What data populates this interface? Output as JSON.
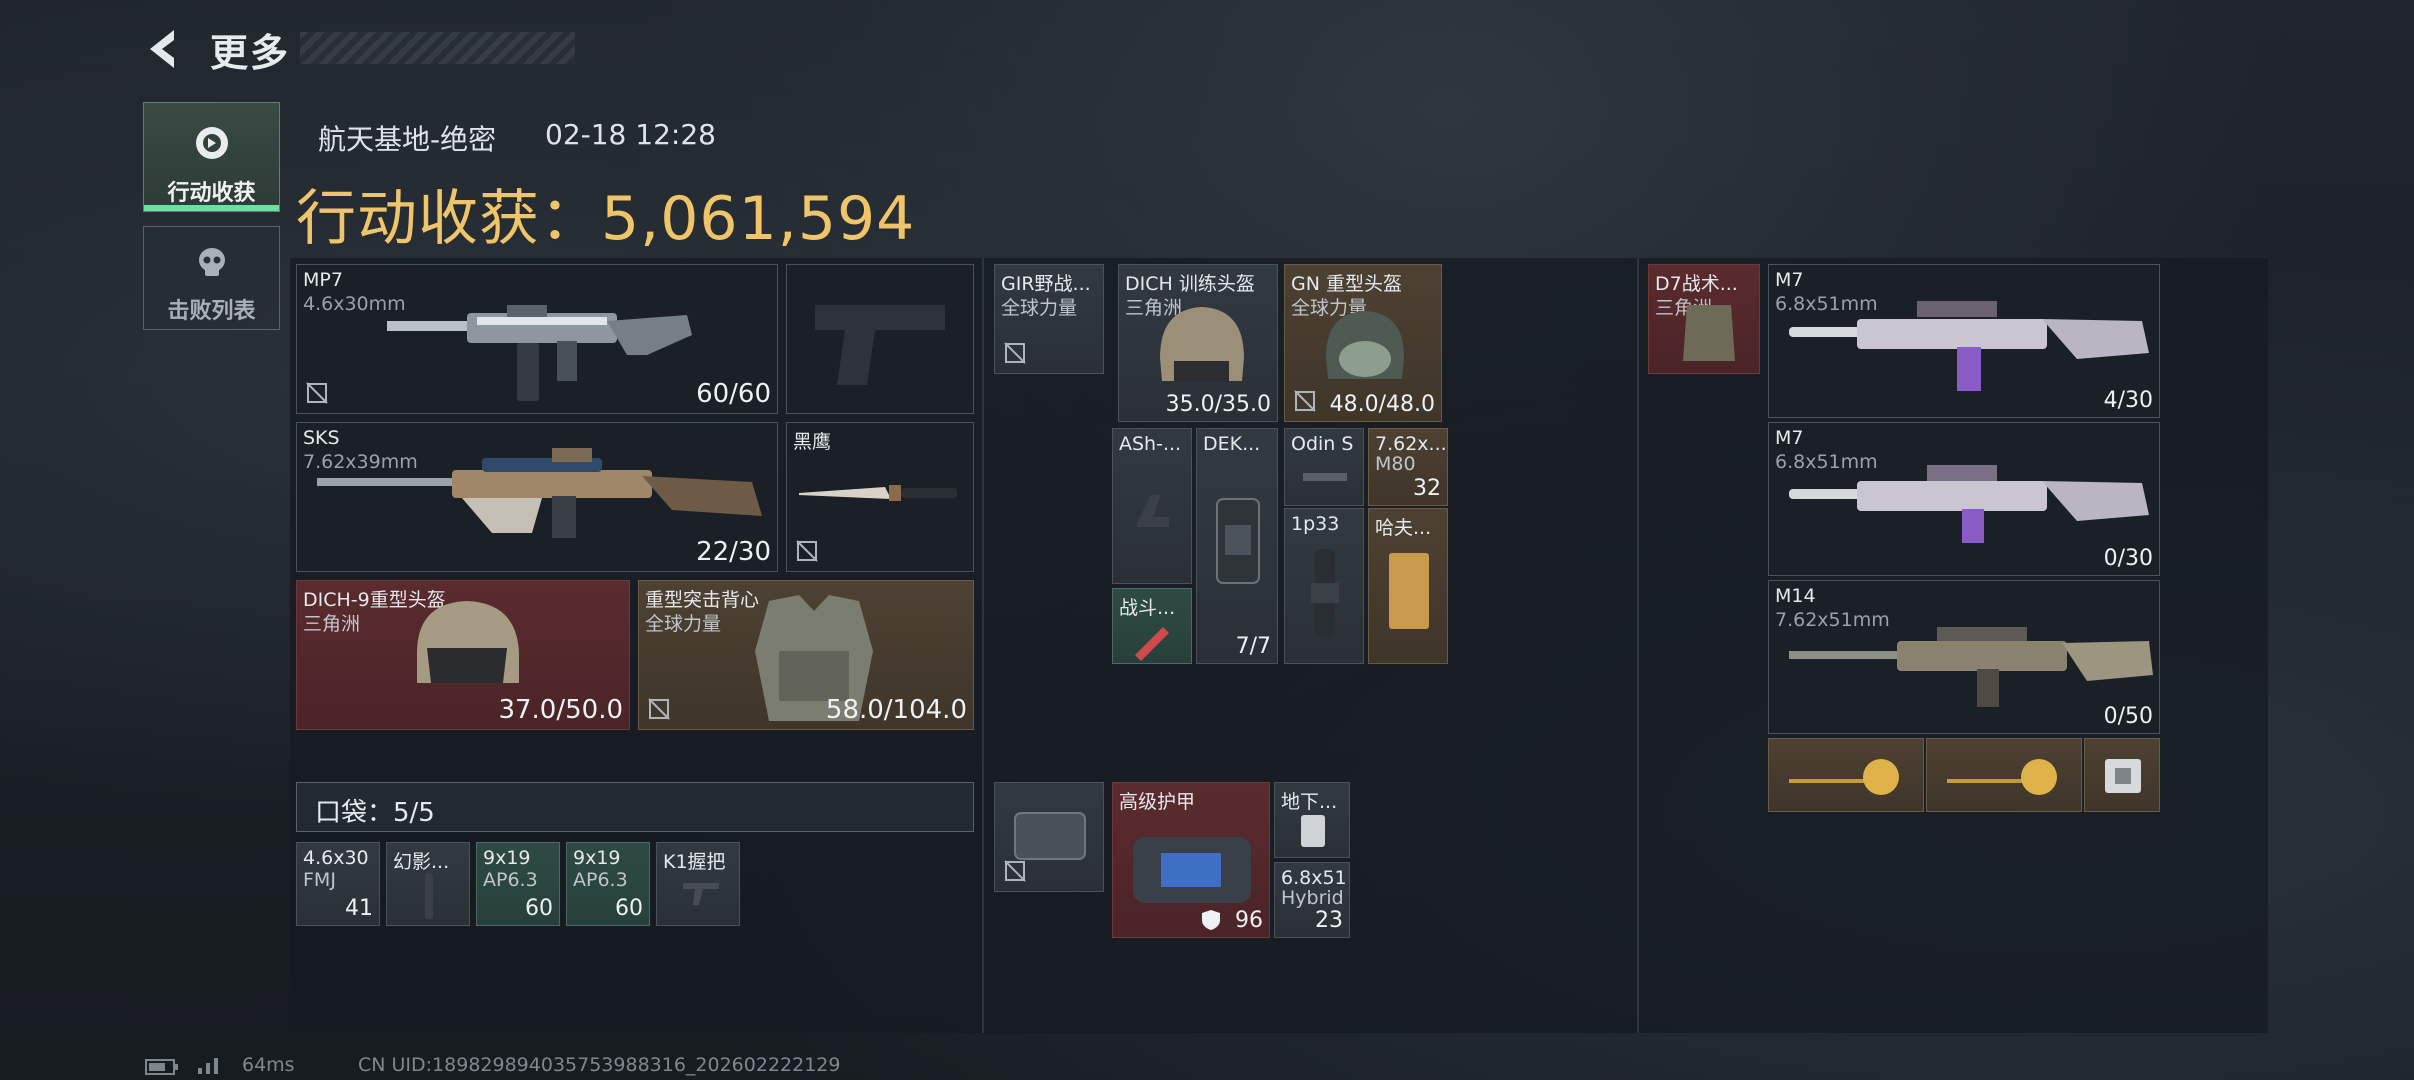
{
  "header": {
    "title": "更多"
  },
  "tabs": [
    {
      "label": "行动收获",
      "icon": "gear-target-icon"
    },
    {
      "label": "击败列表",
      "icon": "skull-icon"
    }
  ],
  "meta": {
    "location": "航天基地-绝密",
    "timestamp": "02-18 12:28"
  },
  "haul": {
    "label": "行动收获：5,061,594"
  },
  "left": {
    "mp7": {
      "name": "MP7",
      "caliber": "4.6x30mm",
      "ammo": "60/60"
    },
    "sks": {
      "name": "SKS",
      "caliber": "7.62x39mm",
      "ammo": "22/30"
    },
    "knife": {
      "name": "黑鹰"
    },
    "helmet": {
      "name": "DICH-9重型头盔",
      "brand": "三角洲",
      "durability": "37.0/50.0"
    },
    "vest": {
      "name": "重型突击背心",
      "brand": "全球力量",
      "durability": "58.0/104.0"
    }
  },
  "pocket": {
    "label": "口袋：5/5",
    "items": [
      {
        "name": "4.6x30",
        "sub": "FMJ",
        "count": "41"
      },
      {
        "name": "幻影...",
        "sub": "",
        "count": ""
      },
      {
        "name": "9x19",
        "sub": "AP6.3",
        "count": "60"
      },
      {
        "name": "9x19",
        "sub": "AP6.3",
        "count": "60"
      },
      {
        "name": "K1握把",
        "sub": "",
        "count": ""
      }
    ]
  },
  "middle": {
    "rig": {
      "name": "GIR野战...",
      "brand": "全球力量"
    },
    "helmet1": {
      "name": "DICH 训练头盔",
      "brand": "三角洲",
      "durability": "35.0/35.0"
    },
    "helmet2": {
      "name": "GN 重型头盔",
      "brand": "全球力量",
      "durability": "48.0/48.0"
    },
    "ash": {
      "name": "ASh-..."
    },
    "dek": {
      "name": "DEK...",
      "count": "7/7"
    },
    "odin": {
      "name": "Odin S"
    },
    "ammo762": {
      "name": "7.62x...",
      "sub": "M80",
      "count": "32"
    },
    "combat": {
      "name": "战斗..."
    },
    "scope": {
      "name": "1p33"
    },
    "doc": {
      "name": "哈夫..."
    },
    "case": {
      "name": ""
    },
    "armor": {
      "name": "高级护甲",
      "count": "96"
    },
    "underground": {
      "name": "地下..."
    },
    "ammo68": {
      "name": "6.8x51",
      "sub": "Hybrid",
      "count": "23"
    }
  },
  "right": {
    "d7": {
      "name": "D7战术...",
      "brand": "三角洲"
    },
    "m7a": {
      "name": "M7",
      "caliber": "6.8x51mm",
      "ammo": "4/30"
    },
    "m7b": {
      "name": "M7",
      "caliber": "6.8x51mm",
      "ammo": "0/30"
    },
    "m14": {
      "name": "M14",
      "caliber": "7.62x51mm",
      "ammo": "0/50"
    }
  },
  "footer": {
    "ping": "64ms",
    "uid": "CN UID:18982989403575398831​6_202602222129"
  },
  "colors": {
    "gold": "#f0c56a",
    "accent_green": "#69e0a2",
    "rarity_red": "#5a2b2f",
    "rarity_gold": "#4d4133"
  }
}
